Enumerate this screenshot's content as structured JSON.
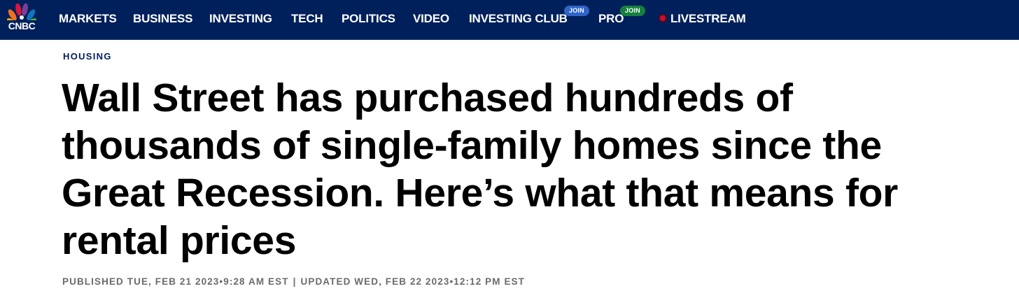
{
  "brand": {
    "logo_text": "CNBC",
    "colors": {
      "nav_background": "#00205b",
      "peacock": [
        "#f7b500",
        "#f37021",
        "#d6153f",
        "#7b3f98",
        "#0f75bc",
        "#55a947"
      ]
    }
  },
  "nav": {
    "items": [
      {
        "label": "MARKETS"
      },
      {
        "label": "BUSINESS"
      },
      {
        "label": "INVESTING"
      },
      {
        "label": "TECH"
      },
      {
        "label": "POLITICS"
      },
      {
        "label": "VIDEO"
      },
      {
        "label": "INVESTING CLUB",
        "badge": "JOIN"
      },
      {
        "label": "PRO",
        "badge": "JOIN"
      },
      {
        "label": "LIVESTREAM",
        "icon": "live-dot-icon"
      }
    ]
  },
  "article": {
    "section": "HOUSING",
    "headline": "Wall Street has purchased hundreds of thousands of single-family homes since the Great Recession. Here’s what that means for rental prices",
    "published": "PUBLISHED TUE, FEB 21 2023•9:28 AM EST",
    "separator": "|",
    "updated": "UPDATED WED, FEB 22 2023•12:12 PM EST"
  }
}
